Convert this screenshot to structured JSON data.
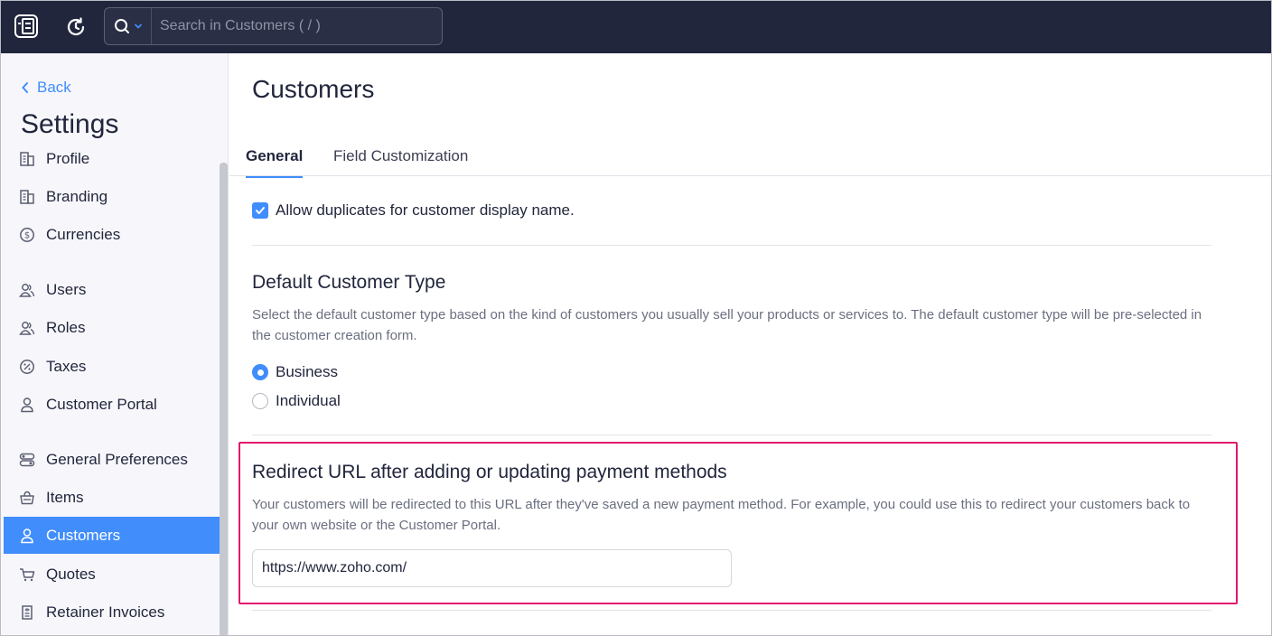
{
  "topbar": {
    "search_placeholder": "Search in Customers ( / )"
  },
  "sidebar": {
    "back_label": "Back",
    "title": "Settings",
    "items": [
      {
        "label": "Profile",
        "icon": "building-icon",
        "active": false
      },
      {
        "label": "Branding",
        "icon": "building-icon",
        "active": false
      },
      {
        "label": "Currencies",
        "icon": "dollar-circle-icon",
        "active": false
      },
      {
        "label": "Users",
        "icon": "users-icon",
        "active": false
      },
      {
        "label": "Roles",
        "icon": "users-icon",
        "active": false
      },
      {
        "label": "Taxes",
        "icon": "percent-circle-icon",
        "active": false
      },
      {
        "label": "Customer Portal",
        "icon": "user-icon",
        "active": false
      },
      {
        "label": "General Preferences",
        "icon": "preferences-icon",
        "active": false
      },
      {
        "label": "Items",
        "icon": "basket-icon",
        "active": false
      },
      {
        "label": "Customers",
        "icon": "user-icon",
        "active": true
      },
      {
        "label": "Quotes",
        "icon": "cart-icon",
        "active": false
      },
      {
        "label": "Retainer Invoices",
        "icon": "invoice-icon",
        "active": false
      }
    ]
  },
  "main": {
    "title": "Customers",
    "tabs": [
      {
        "label": "General",
        "active": true
      },
      {
        "label": "Field Customization",
        "active": false
      }
    ],
    "allow_duplicates": {
      "label": "Allow duplicates for customer display name.",
      "checked": true
    },
    "customer_type": {
      "title": "Default Customer Type",
      "description": "Select the default customer type based on the kind of customers you usually sell your products or services to. The default customer type will be pre-selected in the customer creation form.",
      "options": [
        {
          "label": "Business",
          "selected": true
        },
        {
          "label": "Individual",
          "selected": false
        }
      ]
    },
    "redirect": {
      "title": "Redirect URL after adding or updating payment methods",
      "description": "Your customers will be redirected to this URL after they've saved a new payment method. For example, you could use this to redirect your customers back to your own website or the Customer Portal.",
      "url_value": "https://www.zoho.com/"
    }
  },
  "colors": {
    "topbar_bg": "#21263c",
    "accent": "#408dfb",
    "highlight_border": "#e2186f"
  }
}
